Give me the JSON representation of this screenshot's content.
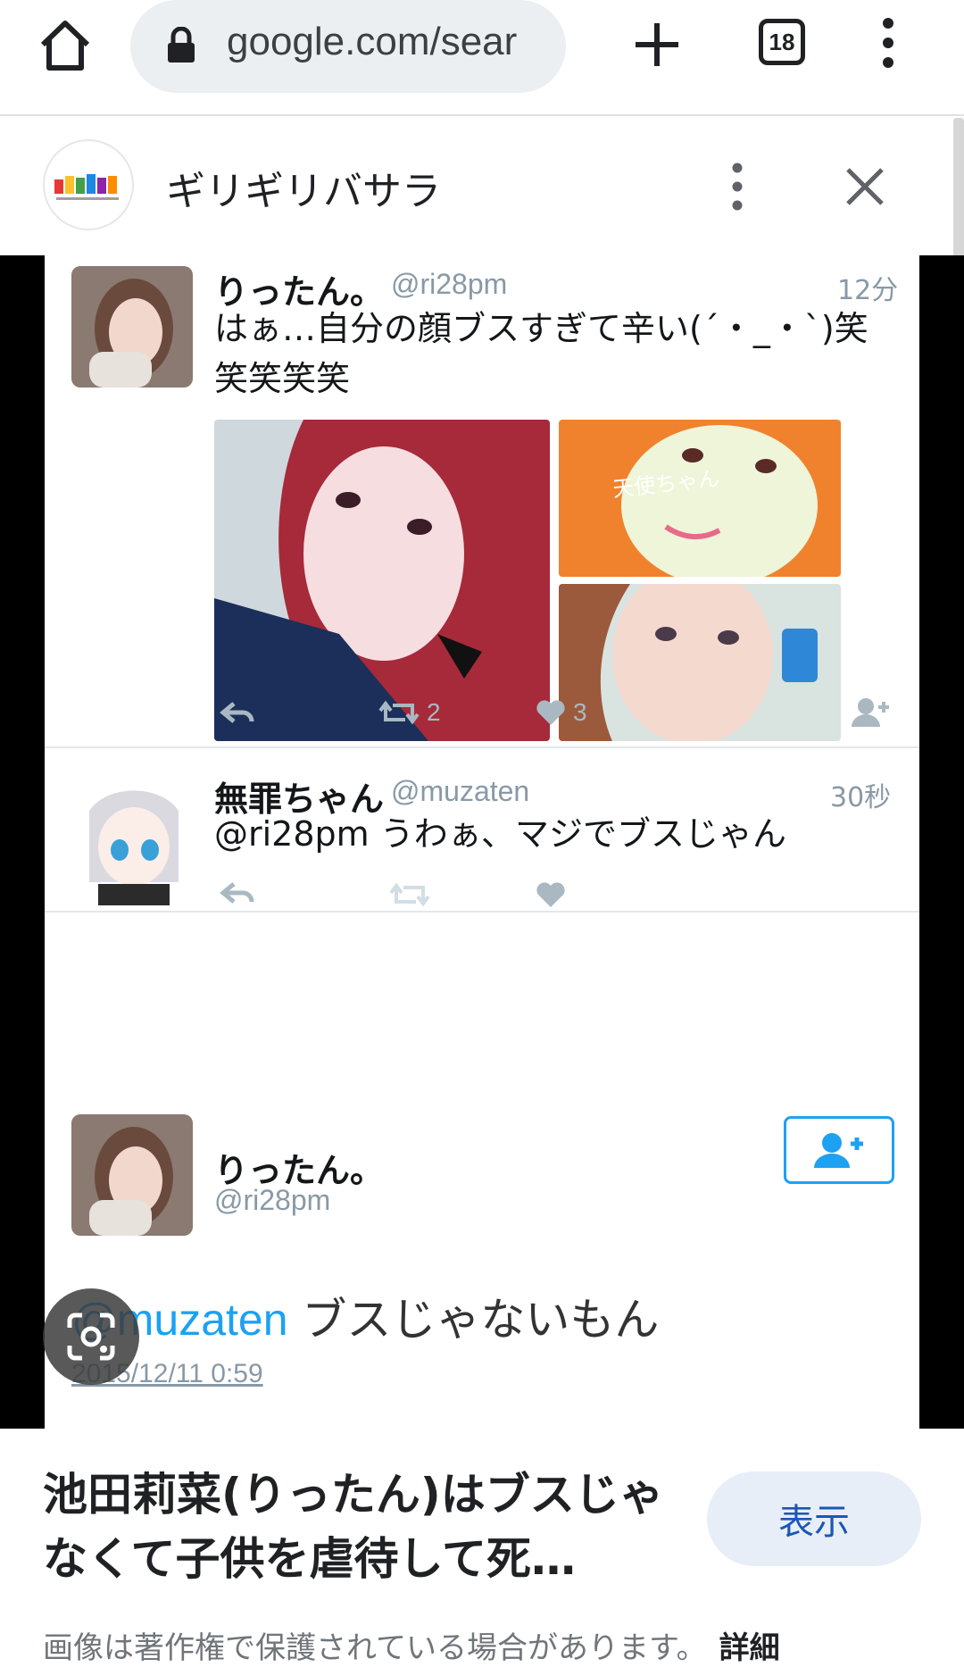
{
  "browser": {
    "url": "google.com/sear",
    "tab_count": "18"
  },
  "site": {
    "title": "ギリギリバサラ",
    "logo_text": "ギリギリバサラ"
  },
  "tweet1": {
    "name": "りったん。",
    "handle": "@ri28pm",
    "time": "12分",
    "body": "はぁ…自分の顔ブスすぎて辛い(´・_・`)笑笑笑笑笑",
    "retweets": "2",
    "likes": "3",
    "photo_overlay_1": "天使ちゃん"
  },
  "tweet2": {
    "name": "無罪ちゃん",
    "handle": "@muzaten",
    "time": "30秒",
    "body": "@ri28pm うわぁ、マジでブスじゃん"
  },
  "tweet3": {
    "name": "りったん。",
    "handle": "@ri28pm",
    "mention": "@muzaten",
    "body": " ブスじゃないもん",
    "date": "2015/12/11 0:59"
  },
  "caption": {
    "title": "池田莉菜(りったん)はブスじゃなくて子供を虐待して死…",
    "show_button": "表示",
    "copyright": "画像は著作権で保護されている場合があります。",
    "details_link": "詳細"
  },
  "colors": {
    "twitter_blue": "#1da1f2",
    "muted": "#8899a6",
    "show_button_bg": "#e8eef8",
    "show_button_text": "#1a57b6"
  }
}
